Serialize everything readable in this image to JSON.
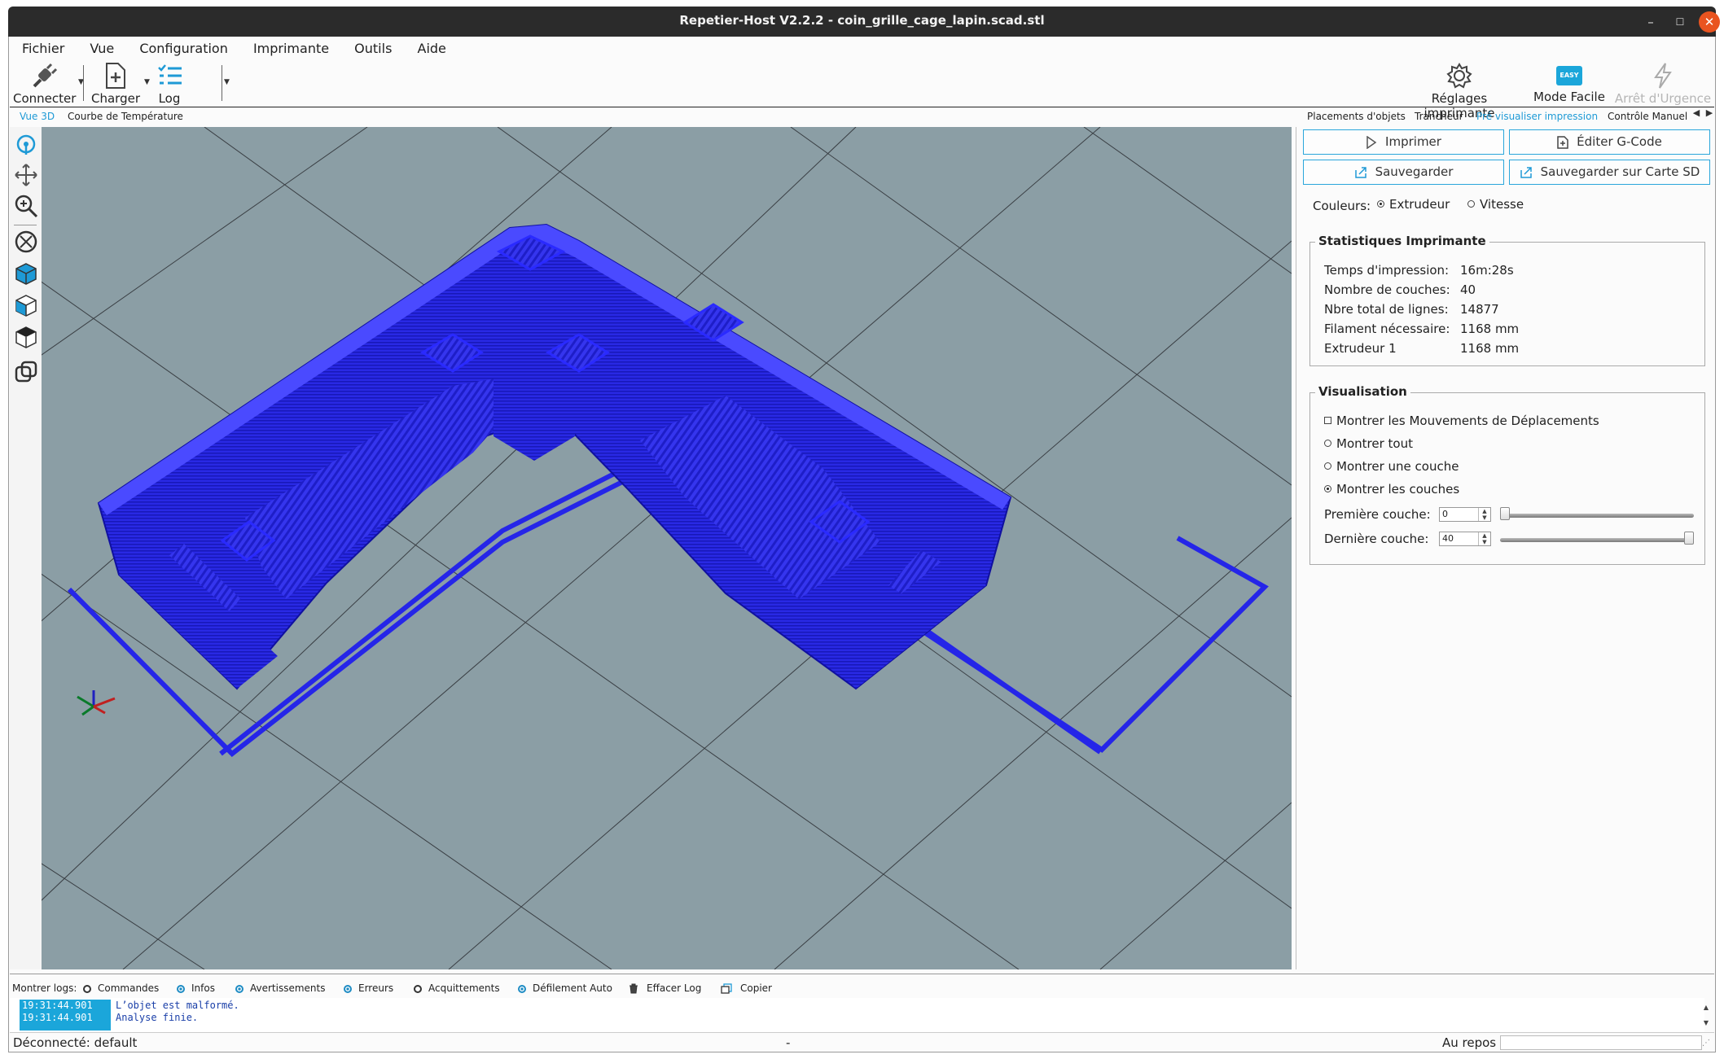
{
  "window": {
    "title": "Repetier-Host V2.2.2 - coin_grille_cage_lapin.scad.stl",
    "controls": {
      "minimize": "–",
      "maximize": "☐",
      "close": "✕"
    }
  },
  "menubar": {
    "items": [
      "Fichier",
      "Vue",
      "Configuration",
      "Imprimante",
      "Outils",
      "Aide"
    ]
  },
  "toolbar": {
    "connect_label": "Connecter",
    "load_label": "Charger",
    "log_label": "Log",
    "printer_settings_label": "Réglages imprimante",
    "easy_mode_label": "Mode Facile",
    "easy_badge": "EASY",
    "emergency_label": "Arrêt d'Urgence"
  },
  "left_tabs": {
    "view3d": "Vue 3D",
    "temp_curve": "Courbe de Température"
  },
  "right_tabs": {
    "objects": "Placements d'objets",
    "slicer": "Trancheur",
    "preview": "Pré visualiser impression",
    "manual": "Contrôle Manuel"
  },
  "panel": {
    "print_button": "Imprimer",
    "edit_gcode_button": "Éditer G-Code",
    "save_button": "Sauvegarder",
    "save_sd_button": "Sauvegarder sur Carte SD",
    "colors_label": "Couleurs:",
    "color_options": {
      "extruder": "Extrudeur",
      "speed": "Vitesse"
    },
    "color_selected": "Extrudeur"
  },
  "stats": {
    "title": "Statistiques Imprimante",
    "rows": [
      {
        "label": "Temps d'impression:",
        "value": "16m:28s"
      },
      {
        "label": "Nombre de couches:",
        "value": "40"
      },
      {
        "label": "Nbre total de lignes:",
        "value": "14877"
      },
      {
        "label": "Filament nécessaire:",
        "value": "1168 mm"
      },
      {
        "label": "Extrudeur 1",
        "value": "1168 mm"
      }
    ]
  },
  "visualisation": {
    "title": "Visualisation",
    "show_travel": "Montrer les Mouvements de Déplacements",
    "show_all": "Montrer tout",
    "show_one": "Montrer une couche",
    "show_layers": "Montrer les couches",
    "selected": "Montrer les couches",
    "first_layer_label": "Première couche:",
    "first_layer_value": "0",
    "last_layer_label": "Dernière couche:",
    "last_layer_value": "40",
    "first_layer_fraction": 0,
    "last_layer_fraction": 1
  },
  "log": {
    "show_logs_label": "Montrer logs:",
    "filters": [
      {
        "label": "Commandes",
        "on": false
      },
      {
        "label": "Infos",
        "on": true
      },
      {
        "label": "Avertissements",
        "on": true
      },
      {
        "label": "Erreurs",
        "on": true
      },
      {
        "label": "Acquittements",
        "on": false
      },
      {
        "label": "Défilement Auto",
        "on": true
      }
    ],
    "clear_label": "Effacer Log",
    "copy_label": "Copier",
    "entries": [
      {
        "time": "19:31:44.901",
        "message": "L’objet est malformé."
      },
      {
        "time": "19:31:44.901",
        "message": "Analyse finie."
      }
    ]
  },
  "status": {
    "connection": "Déconnecté: default",
    "middle": "-",
    "state": "Au repos"
  },
  "colors": {
    "accent": "#1e9ad6",
    "model": "#2a2af0",
    "viewport_bg": "#8b9ea5",
    "titlebar": "#2b2b2b",
    "close": "#e95420"
  }
}
